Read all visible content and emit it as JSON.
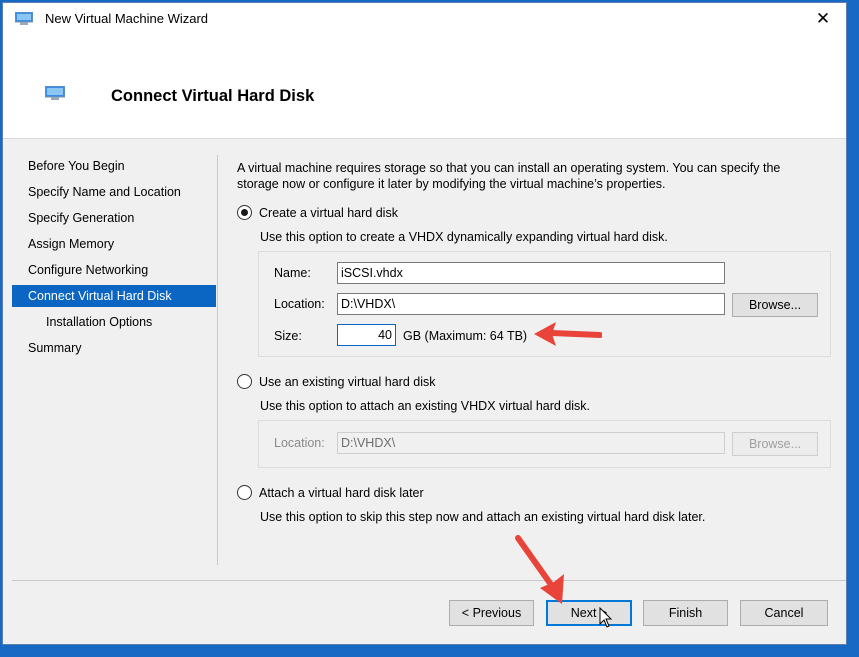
{
  "window": {
    "title": "New Virtual Machine Wizard",
    "close_glyph": "✕"
  },
  "header": {
    "title": "Connect Virtual Hard Disk"
  },
  "nav": {
    "items": [
      {
        "label": "Before You Begin"
      },
      {
        "label": "Specify Name and Location"
      },
      {
        "label": "Specify Generation"
      },
      {
        "label": "Assign Memory"
      },
      {
        "label": "Configure Networking"
      },
      {
        "label": "Connect Virtual Hard Disk"
      },
      {
        "label": "Installation Options"
      },
      {
        "label": "Summary"
      }
    ],
    "active_index": 5
  },
  "main": {
    "intro": "A virtual machine requires storage so that you can install an operating system. You can specify the storage now or configure it later by modifying the virtual machine’s properties.",
    "option_create": {
      "label": "Create a virtual hard disk",
      "selected": true,
      "hint": "Use this option to create a VHDX dynamically expanding virtual hard disk.",
      "name_label": "Name:",
      "name_value": "iSCSI.vhdx",
      "location_label": "Location:",
      "location_value": "D:\\VHDX\\",
      "browse_label": "Browse...",
      "size_label": "Size:",
      "size_value": "40",
      "size_unit": "GB (Maximum: 64 TB)"
    },
    "option_existing": {
      "label": "Use an existing virtual hard disk",
      "selected": false,
      "hint": "Use this option to attach an existing VHDX virtual hard disk.",
      "location_label": "Location:",
      "location_value": "D:\\VHDX\\",
      "browse_label": "Browse..."
    },
    "option_later": {
      "label": "Attach a virtual hard disk later",
      "selected": false,
      "hint": "Use this option to skip this step now and attach an existing virtual hard disk later."
    }
  },
  "footer": {
    "previous_label": "< Previous",
    "next_label": "Next >",
    "finish_label": "Finish",
    "cancel_label": "Cancel"
  },
  "colors": {
    "accent": "#0a66c2",
    "annotation_arrow": "#e8443a",
    "desktop": "#1769c4"
  }
}
